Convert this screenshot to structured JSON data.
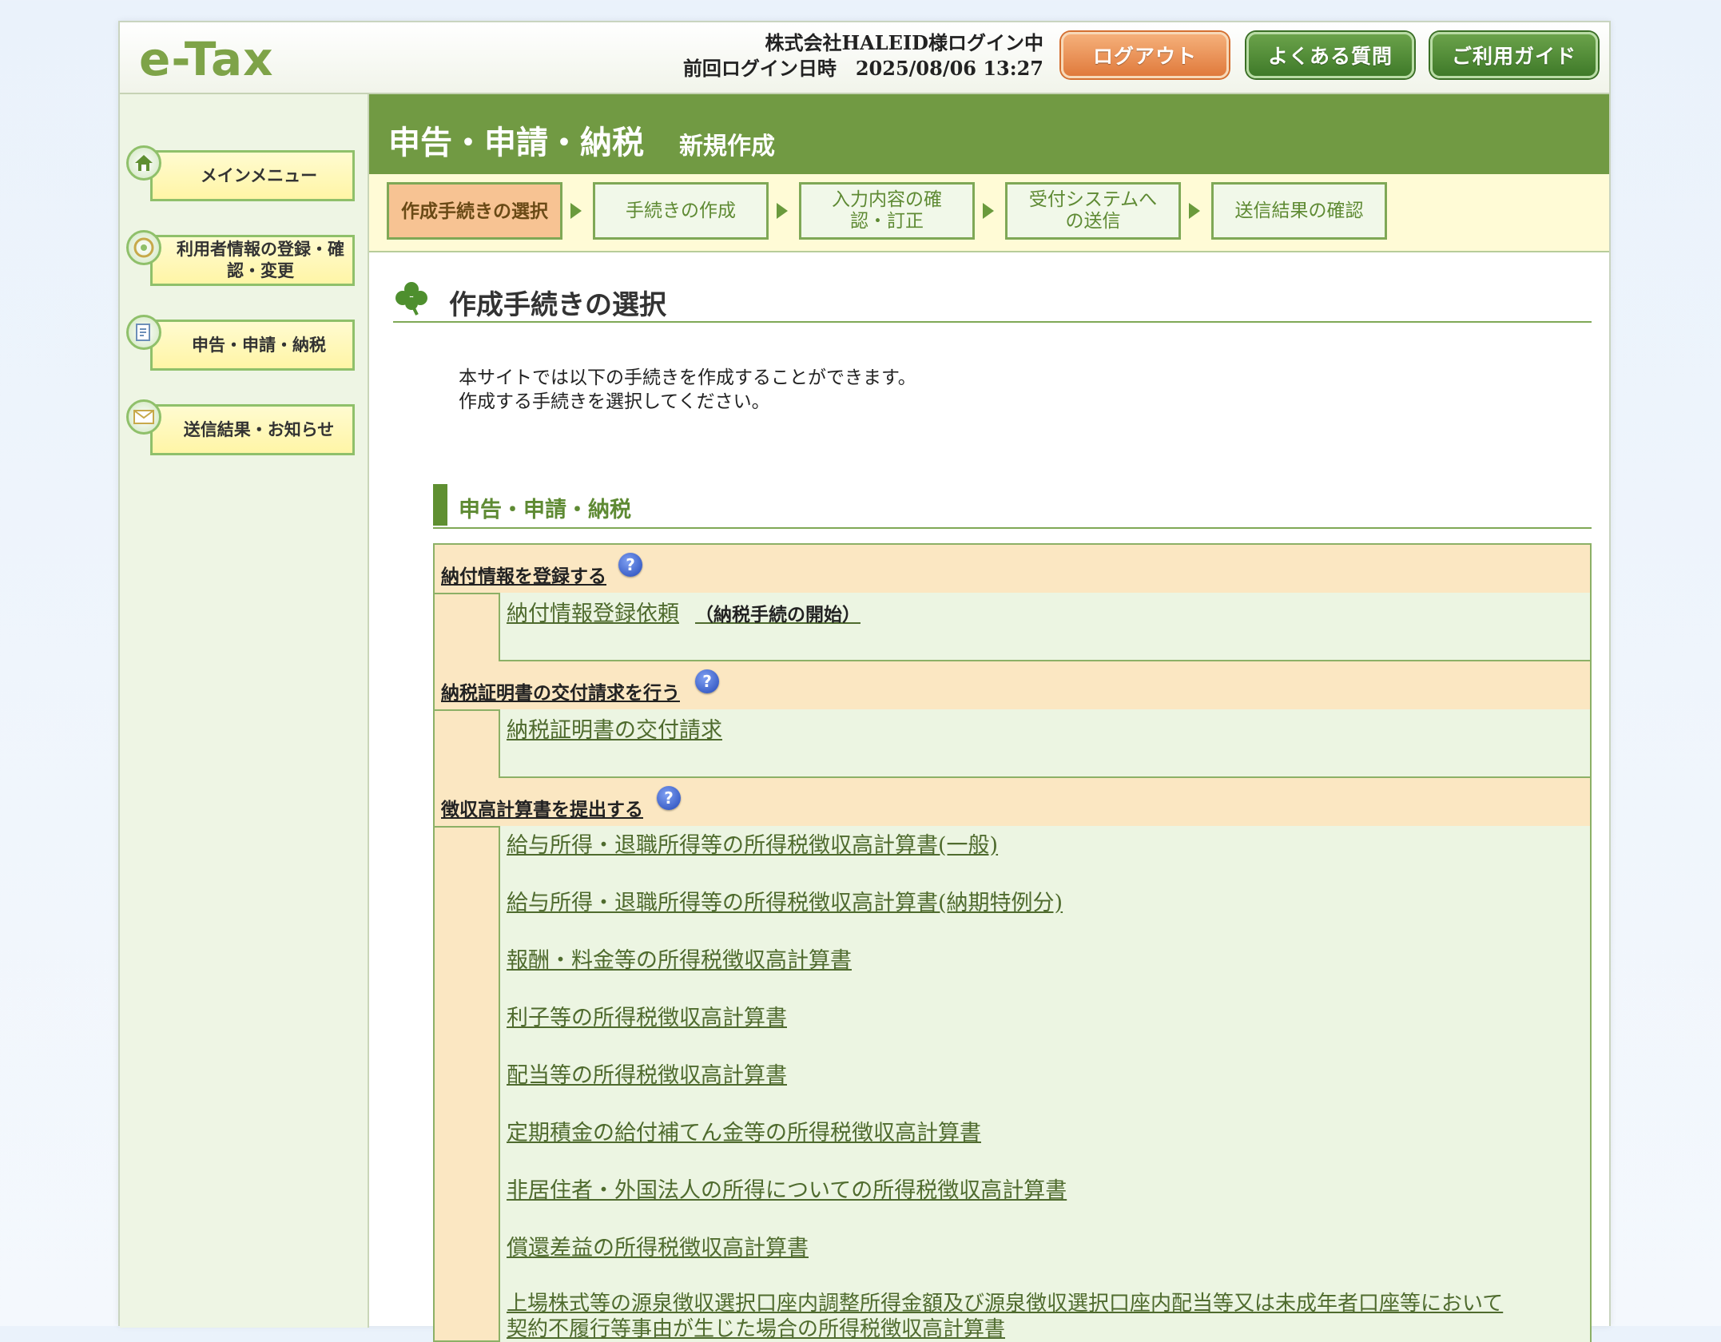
{
  "header": {
    "logo": "e-Tax",
    "login_user": "株式会社HALEID様ログイン中",
    "last_login": "前回ログイン日時　2025/08/06 13:27",
    "logout_label": "ログアウト",
    "faq_label": "よくある質問",
    "guide_label": "ご利用ガイド"
  },
  "sidebar": {
    "items": [
      {
        "label": "メインメニュー",
        "icon": "home-icon"
      },
      {
        "label": "利用者情報の登録・確認・変更",
        "icon": "user-info-icon"
      },
      {
        "label": "申告・申請・納税",
        "icon": "declaration-icon"
      },
      {
        "label": "送信結果・お知らせ",
        "icon": "mail-icon"
      }
    ]
  },
  "main": {
    "title": "申告・申請・納税",
    "subtitle": "新規作成",
    "steps": [
      {
        "label": "作成手続きの選択",
        "active": true
      },
      {
        "label": "手続きの作成",
        "active": false
      },
      {
        "label": "入力内容の確認・訂正",
        "active": false
      },
      {
        "label": "受付システムへの送信",
        "active": false
      },
      {
        "label": "送信結果の確認",
        "active": false
      }
    ],
    "section_title": "作成手続きの選択",
    "intro_line1": "本サイトでは以下の手続きを作成することができます。",
    "intro_line2": "作成する手続きを選択してください。",
    "category_title": "申告・申請・納税",
    "groups": [
      {
        "header": "納付情報を登録する",
        "items": [
          {
            "label": "納付情報登録依頼",
            "note": "（納税手続の開始）"
          }
        ]
      },
      {
        "header": "納税証明書の交付請求を行う",
        "items": [
          {
            "label": "納税証明書の交付請求"
          }
        ]
      },
      {
        "header": "徴収高計算書を提出する",
        "items": [
          {
            "label": "給与所得・退職所得等の所得税徴収高計算書(一般)"
          },
          {
            "label": "給与所得・退職所得等の所得税徴収高計算書(納期特例分)"
          },
          {
            "label": "報酬・料金等の所得税徴収高計算書"
          },
          {
            "label": "利子等の所得税徴収高計算書"
          },
          {
            "label": "配当等の所得税徴収高計算書"
          },
          {
            "label": "定期積金の給付補てん金等の所得税徴収高計算書"
          },
          {
            "label": "非居住者・外国法人の所得についての所得税徴収高計算書"
          },
          {
            "label": "償還差益の所得税徴収高計算書"
          },
          {
            "label_line1": "上場株式等の源泉徴収選択口座内調整所得金額及び源泉徴収選択口座内配当等又は未成年者口座等において",
            "label_line2": "契約不履行等事由が生じた場合の所得税徴収高計算書"
          }
        ]
      }
    ]
  }
}
